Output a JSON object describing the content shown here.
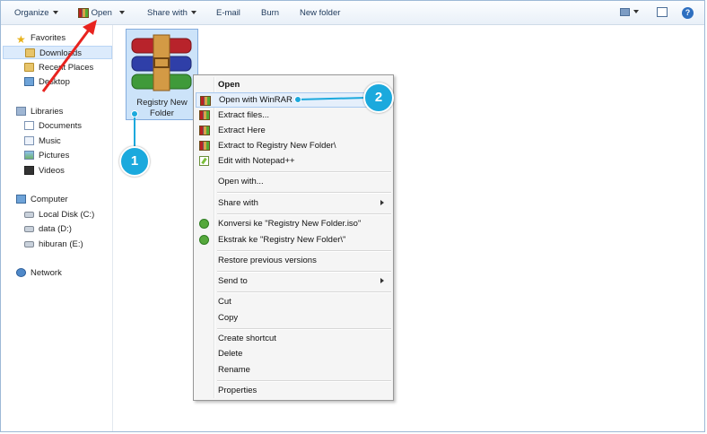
{
  "toolbar": {
    "organize": "Organize",
    "open": "Open",
    "share_with": "Share with",
    "email": "E-mail",
    "burn": "Burn",
    "new_folder": "New folder",
    "help": "?"
  },
  "sidebar": {
    "favorites": "Favorites",
    "downloads": "Downloads",
    "recent_places": "Recent Places",
    "desktop": "Desktop",
    "libraries": "Libraries",
    "documents": "Documents",
    "music": "Music",
    "pictures": "Pictures",
    "videos": "Videos",
    "computer": "Computer",
    "local_disk": "Local Disk (C:)",
    "data": "data (D:)",
    "hiburan": "hiburan (E:)",
    "network": "Network"
  },
  "file": {
    "name_line1": "Registry New",
    "name_line2": "Folder"
  },
  "menu": {
    "open": "Open",
    "open_winrar": "Open with WinRAR",
    "extract_files": "Extract files...",
    "extract_here": "Extract Here",
    "extract_to": "Extract to Registry New Folder\\",
    "edit_notepad": "Edit with Notepad++",
    "open_with": "Open with...",
    "share_with": "Share with",
    "konversi": "Konversi ke \"Registry New Folder.iso\"",
    "ekstrak": "Ekstrak ke \"Registry New Folder\\\"",
    "restore": "Restore previous versions",
    "send_to": "Send to",
    "cut": "Cut",
    "copy": "Copy",
    "create_shortcut": "Create shortcut",
    "delete": "Delete",
    "rename": "Rename",
    "properties": "Properties"
  },
  "callouts": {
    "one": "1",
    "two": "2"
  },
  "colors": {
    "callout": "#1ba9dd",
    "arrow": "#e8231f",
    "selection": "#cce3f9"
  }
}
